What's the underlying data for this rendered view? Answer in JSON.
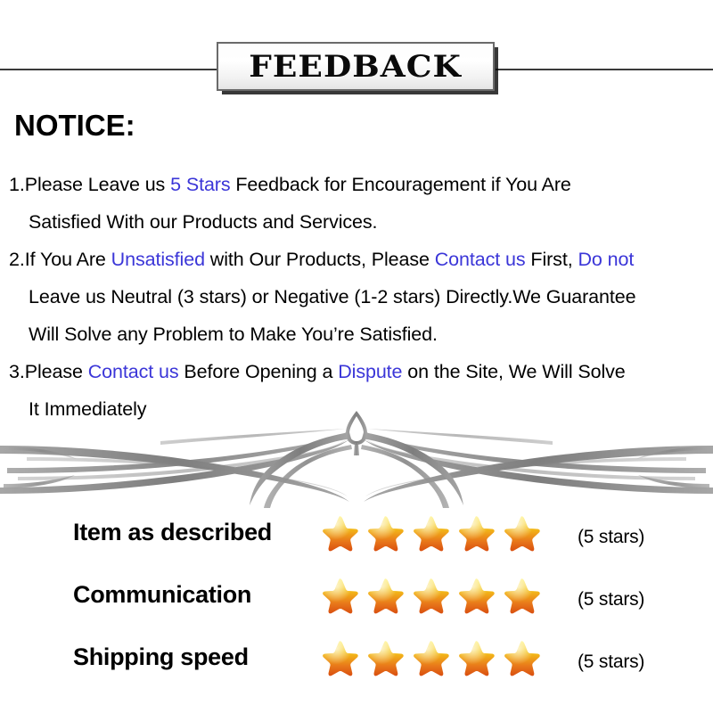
{
  "banner": {
    "title": "FEEDBACK",
    "rule_color": "#3a3a3a"
  },
  "notice": {
    "heading": "NOTICE:",
    "highlight_color": "#3b36d8",
    "items": [
      {
        "number": "1.",
        "lines": [
          [
            {
              "text": "Please Leave us  ",
              "highlight": false
            },
            {
              "text": "5 Stars",
              "highlight": true
            },
            {
              "text": "  Feedback for  Encouragement  if You Are",
              "highlight": false
            }
          ],
          [
            {
              "text": "Satisfied With our Products and Services.",
              "highlight": false
            }
          ]
        ]
      },
      {
        "number": "2.",
        "lines": [
          [
            {
              "text": "If You Are ",
              "highlight": false
            },
            {
              "text": "Unsatisfied",
              "highlight": true
            },
            {
              "text": " with Our Products, Please ",
              "highlight": false
            },
            {
              "text": "Contact us",
              "highlight": true
            },
            {
              "text": " First, ",
              "highlight": false
            },
            {
              "text": "Do not",
              "highlight": true
            }
          ],
          [
            {
              "text": "Leave us Neutral (3 stars) or Negative (1-2 stars) Directly.We Guarantee",
              "highlight": false
            }
          ],
          [
            {
              "text": "Will Solve any Problem to Make You’re  Satisfied.",
              "highlight": false
            }
          ]
        ]
      },
      {
        "number": "3.",
        "lines": [
          [
            {
              "text": "Please ",
              "highlight": false
            },
            {
              "text": "Contact us",
              "highlight": true
            },
            {
              "text": " Before Opening a ",
              "highlight": false
            },
            {
              "text": "Dispute",
              "highlight": true
            },
            {
              "text": " on the Site, We Will Solve",
              "highlight": false
            }
          ],
          [
            {
              "text": "It Immediately",
              "highlight": false
            }
          ]
        ]
      }
    ]
  },
  "ornament": {
    "icon": "filigree-flourish-divider",
    "color": "#8c8c8c"
  },
  "ratings": {
    "star_icon": "star-icon",
    "star_colors": {
      "top": "#fff27a",
      "mid": "#f5c518",
      "bottom": "#e8771a",
      "edge": "#d94f10"
    },
    "rows": [
      {
        "label": "Item as described",
        "stars": 5,
        "count_text": "(5 stars)"
      },
      {
        "label": "Communication",
        "stars": 5,
        "count_text": "(5 stars)"
      },
      {
        "label": "Shipping speed",
        "stars": 5,
        "count_text": "(5 stars)"
      }
    ]
  }
}
